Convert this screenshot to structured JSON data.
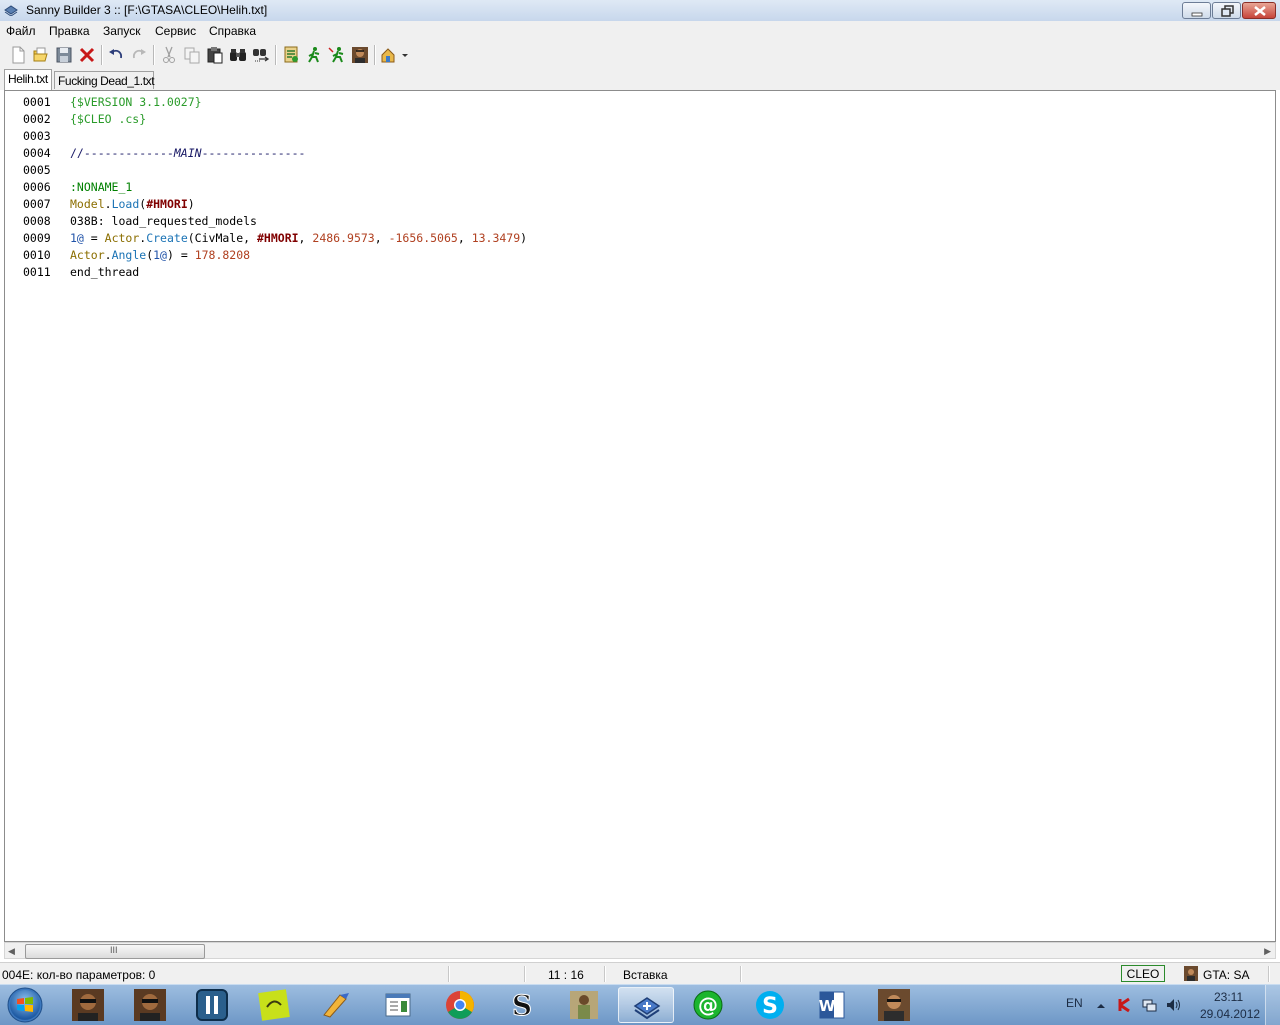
{
  "window": {
    "title": "Sanny Builder 3 :: [F:\\GTASA\\CLEO\\Helih.txt]"
  },
  "menu": [
    "Файл",
    "Правка",
    "Запуск",
    "Сервис",
    "Справка"
  ],
  "toolbar": [
    "new-file-icon",
    "open-folder-icon",
    "save-icon",
    "close-x-icon",
    "undo-icon",
    "redo-icon",
    "cut-icon",
    "copy-icon",
    "paste-icon",
    "find-binoculars-icon",
    "replace-icon",
    "compile-icon",
    "run-icon",
    "run-debug-icon",
    "gta-player-icon",
    "tools-dropdown-icon"
  ],
  "tabs": [
    {
      "label": "Helih.txt",
      "active": true
    },
    {
      "label": "Fucking Dead_1.txt",
      "active": false
    }
  ],
  "editor": {
    "lines": [
      {
        "num": "0001",
        "parts": [
          {
            "t": "{$VERSION 3.1.0027}",
            "c": "c-dir"
          }
        ]
      },
      {
        "num": "0002",
        "parts": [
          {
            "t": "{$CLEO .cs}",
            "c": "c-dir"
          }
        ]
      },
      {
        "num": "0003",
        "parts": []
      },
      {
        "num": "0004",
        "parts": [
          {
            "t": "//-------------",
            "c": "c-comment"
          },
          {
            "t": "MAIN",
            "c": "c-comment-i"
          },
          {
            "t": "---------------",
            "c": "c-comment"
          }
        ]
      },
      {
        "num": "0005",
        "parts": []
      },
      {
        "num": "0006",
        "parts": [
          {
            "t": ":NONAME_1",
            "c": "c-label"
          }
        ]
      },
      {
        "num": "0007",
        "parts": [
          {
            "t": "Model",
            "c": "c-class"
          },
          {
            "t": ".",
            "c": "c-plain"
          },
          {
            "t": "Load",
            "c": "c-method"
          },
          {
            "t": "(",
            "c": "c-plain"
          },
          {
            "t": "#HMORI",
            "c": "c-model"
          },
          {
            "t": ")",
            "c": "c-plain"
          }
        ]
      },
      {
        "num": "0008",
        "parts": [
          {
            "t": "038B: load_requested_models",
            "c": "c-plain"
          }
        ]
      },
      {
        "num": "0009",
        "parts": [
          {
            "t": "1@",
            "c": "c-var"
          },
          {
            "t": " = ",
            "c": "c-plain"
          },
          {
            "t": "Actor",
            "c": "c-class"
          },
          {
            "t": ".",
            "c": "c-plain"
          },
          {
            "t": "Create",
            "c": "c-method"
          },
          {
            "t": "(CivMale, ",
            "c": "c-plain"
          },
          {
            "t": "#HMORI",
            "c": "c-model"
          },
          {
            "t": ", ",
            "c": "c-plain"
          },
          {
            "t": "2486.9573",
            "c": "c-num"
          },
          {
            "t": ", ",
            "c": "c-plain"
          },
          {
            "t": "-1656.5065",
            "c": "c-num"
          },
          {
            "t": ", ",
            "c": "c-plain"
          },
          {
            "t": "13.3479",
            "c": "c-num"
          },
          {
            "t": ")",
            "c": "c-plain"
          }
        ]
      },
      {
        "num": "0010",
        "parts": [
          {
            "t": "Actor",
            "c": "c-class"
          },
          {
            "t": ".",
            "c": "c-plain"
          },
          {
            "t": "Angle",
            "c": "c-method"
          },
          {
            "t": "(",
            "c": "c-plain"
          },
          {
            "t": "1@",
            "c": "c-var"
          },
          {
            "t": ") = ",
            "c": "c-plain"
          },
          {
            "t": "178.8208",
            "c": "c-num"
          }
        ]
      },
      {
        "num": "0011",
        "parts": [
          {
            "t": "end_thread",
            "c": "c-plain"
          }
        ]
      }
    ]
  },
  "scrollbar": {
    "grip": "III"
  },
  "status": {
    "message": "004E: кол-во параметров: 0",
    "position": "11 : 16",
    "mode": "Вставка",
    "cleo": "CLEO",
    "game": "GTA: SA"
  },
  "taskbar": {
    "apps": [
      "gta-char-icon",
      "gta-char-icon",
      "pause-app-icon",
      "green-sticker-icon",
      "paint-brush-icon",
      "editor-window-icon",
      "chrome-icon",
      "s-logo-icon",
      "gta-screen-icon",
      "sanny-builder-icon",
      "mail-agent-icon",
      "skype-icon",
      "word-icon",
      "gta-player-icon"
    ],
    "lang": "EN",
    "time": "23:11",
    "date": "29.04.2012"
  }
}
